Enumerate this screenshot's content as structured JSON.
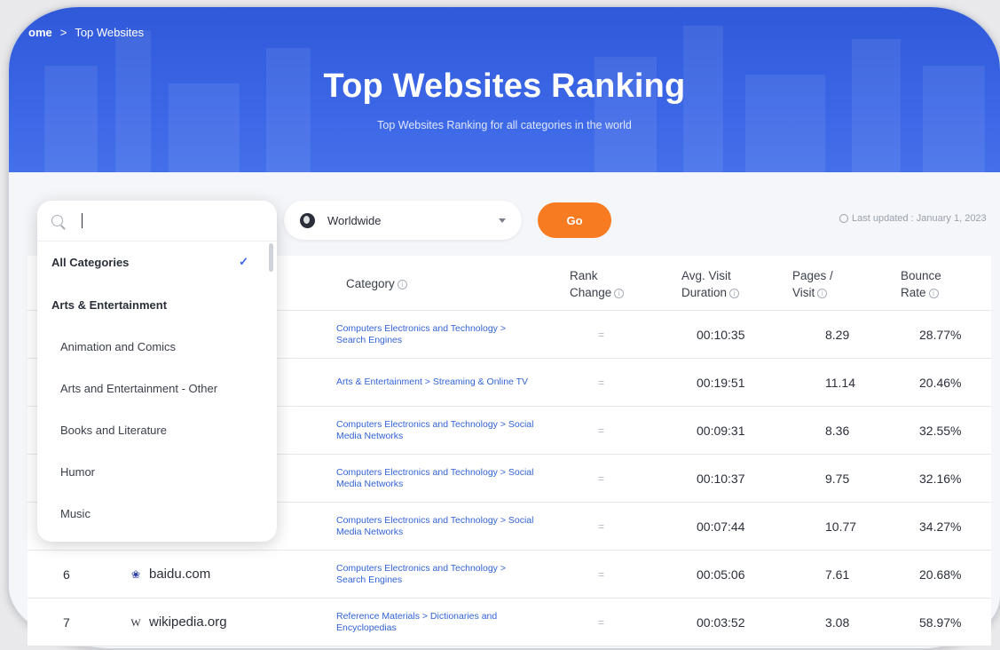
{
  "breadcrumb": {
    "home": "ome",
    "separator": ">",
    "current": "Top Websites"
  },
  "hero": {
    "title": "Top Websites Ranking",
    "subtitle": "Top Websites Ranking for all categories in the world"
  },
  "filters": {
    "search_value": "",
    "country": "Worldwide",
    "go_label": "Go",
    "last_updated": "Last updated : January 1, 2023"
  },
  "dropdown": {
    "items": [
      {
        "label": "All Categories",
        "type": "group",
        "selected": true
      },
      {
        "label": "Arts & Entertainment",
        "type": "group"
      },
      {
        "label": "Animation and Comics",
        "type": "sub"
      },
      {
        "label": "Arts and Entertainment - Other",
        "type": "sub"
      },
      {
        "label": "Books and Literature",
        "type": "sub"
      },
      {
        "label": "Humor",
        "type": "sub"
      },
      {
        "label": "Music",
        "type": "sub"
      }
    ]
  },
  "table": {
    "headers": {
      "category": "Category",
      "rank_change_1": "Rank",
      "rank_change_2": "Change",
      "duration_1": "Avg. Visit",
      "duration_2": "Duration",
      "pages_1": "Pages /",
      "pages_2": "Visit",
      "bounce_1": "Bounce",
      "bounce_2": "Rate",
      "info_glyph": "i"
    },
    "rows": [
      {
        "rank": "",
        "site": "",
        "icon": "",
        "category": "Computers Electronics and Technology > Search Engines",
        "rank_change": "=",
        "duration": "00:10:35",
        "pages": "8.29",
        "bounce": "28.77%"
      },
      {
        "rank": "",
        "site": "",
        "icon": "",
        "category": "Arts & Entertainment > Streaming & Online TV",
        "rank_change": "=",
        "duration": "00:19:51",
        "pages": "11.14",
        "bounce": "20.46%"
      },
      {
        "rank": "",
        "site": "",
        "icon": "",
        "category": "Computers Electronics and Technology > Social Media Networks",
        "rank_change": "=",
        "duration": "00:09:31",
        "pages": "8.36",
        "bounce": "32.55%"
      },
      {
        "rank": "",
        "site": "",
        "icon": "",
        "category": "Computers Electronics and Technology > Social Media Networks",
        "rank_change": "=",
        "duration": "00:10:37",
        "pages": "9.75",
        "bounce": "32.16%"
      },
      {
        "rank": "",
        "site": "",
        "icon": "",
        "category": "Computers Electronics and Technology > Social Media Networks",
        "rank_change": "=",
        "duration": "00:07:44",
        "pages": "10.77",
        "bounce": "34.27%"
      },
      {
        "rank": "6",
        "site": "baidu.com",
        "icon": "❀",
        "category": "Computers Electronics and Technology > Search Engines",
        "rank_change": "=",
        "duration": "00:05:06",
        "pages": "7.61",
        "bounce": "20.68%"
      },
      {
        "rank": "7",
        "site": "wikipedia.org",
        "icon": "W",
        "category": "Reference Materials > Dictionaries and Encyclopedias",
        "rank_change": "=",
        "duration": "00:03:52",
        "pages": "3.08",
        "bounce": "58.97%"
      }
    ]
  }
}
